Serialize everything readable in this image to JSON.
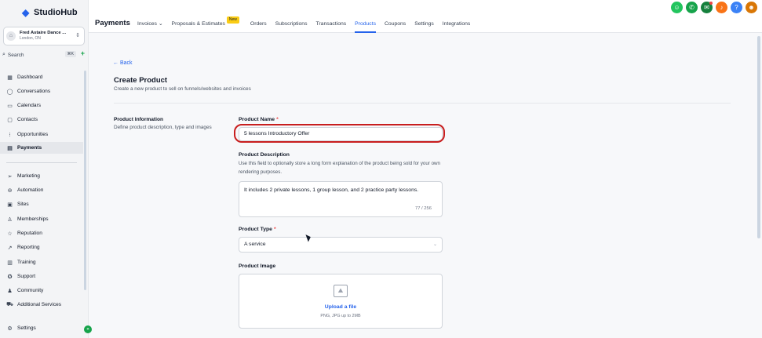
{
  "sidebar": {
    "logo": "StudioHub",
    "account": {
      "name": "Fred Astaire Dance ...",
      "location": "London, ON",
      "avatar_icon": "store-icon"
    },
    "search": {
      "label": "Search",
      "shortcut": "⌘K"
    },
    "items": [
      {
        "label": "Dashboard",
        "icon": "grid-icon"
      },
      {
        "label": "Conversations",
        "icon": "chat-icon"
      },
      {
        "label": "Calendars",
        "icon": "calendar-icon"
      },
      {
        "label": "Contacts",
        "icon": "contacts-icon"
      },
      {
        "label": "Opportunities",
        "icon": "funnel-icon"
      },
      {
        "label": "Payments",
        "icon": "receipt-icon",
        "active": true
      },
      {
        "label": "Marketing",
        "icon": "send-icon"
      },
      {
        "label": "Automation",
        "icon": "automation-icon"
      },
      {
        "label": "Sites",
        "icon": "sites-icon"
      },
      {
        "label": "Memberships",
        "icon": "membership-icon"
      },
      {
        "label": "Reputation",
        "icon": "star-icon"
      },
      {
        "label": "Reporting",
        "icon": "chart-icon"
      },
      {
        "label": "Training",
        "icon": "book-icon"
      },
      {
        "label": "Support",
        "icon": "support-icon"
      },
      {
        "label": "Community",
        "icon": "community-icon"
      },
      {
        "label": "Additional Services",
        "icon": "cart-icon"
      },
      {
        "label": "Settings",
        "icon": "gear-icon"
      }
    ]
  },
  "header": {
    "title": "Payments",
    "tabs": [
      {
        "label": "Invoices",
        "dropdown": true
      },
      {
        "label": "Proposals & Estimates",
        "badge": "New"
      },
      {
        "label": "Orders"
      },
      {
        "label": "Subscriptions"
      },
      {
        "label": "Transactions"
      },
      {
        "label": "Products",
        "active": true
      },
      {
        "label": "Coupons"
      },
      {
        "label": "Settings"
      },
      {
        "label": "Integrations"
      }
    ],
    "top_icons": [
      {
        "name": "contact-icon",
        "color": "#22c55e"
      },
      {
        "name": "phone-icon",
        "color": "#16a34a"
      },
      {
        "name": "megaphone-icon",
        "color": "#15803d"
      },
      {
        "name": "bell-icon",
        "color": "#f97316"
      },
      {
        "name": "help-icon",
        "color": "#3b82f6"
      },
      {
        "name": "user-avatar-icon",
        "color": "#d97706"
      }
    ]
  },
  "main": {
    "back": "Back",
    "title": "Create Product",
    "subtitle": "Create a new product to sell on funnels/websites and invoices",
    "section": {
      "title": "Product Information",
      "description": "Define product description, type and images"
    },
    "product_name": {
      "label": "Product Name",
      "value": "5 lessons Introductory Offer"
    },
    "product_description": {
      "label": "Product Description",
      "help": "Use this field to optionally store a long form explanation of the product being sold for your own rendering purposes.",
      "value": "It includes 2 private lessons, 1 group lesson, and 2 practice party lessons.",
      "counter": "77 / 256"
    },
    "product_type": {
      "label": "Product Type",
      "value": "A service"
    },
    "product_image": {
      "label": "Product Image",
      "upload": "Upload a file",
      "hint": "PNG, JPG up to 2MB"
    },
    "required_mark": "*"
  },
  "colors": {
    "accent": "#2563eb",
    "highlight": "#c81e1e",
    "required": "#ef4444"
  }
}
